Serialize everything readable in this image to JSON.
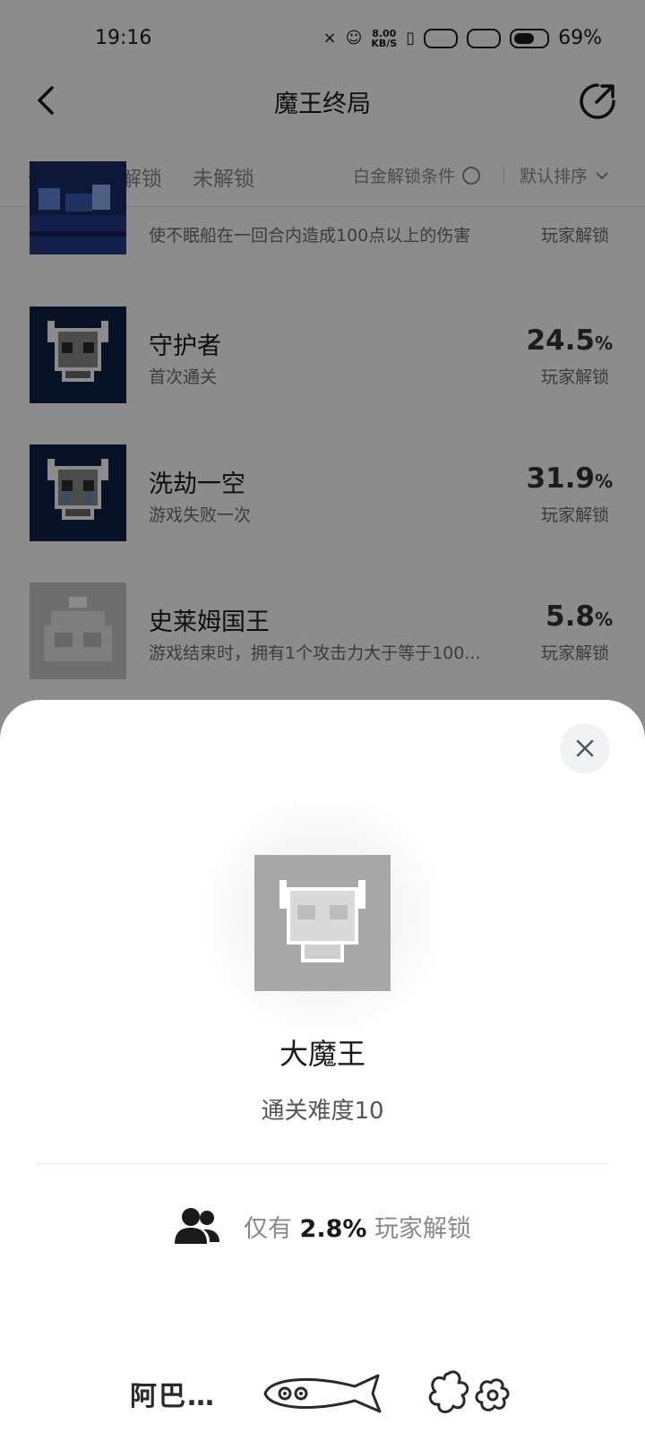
{
  "status_bar": {
    "time": "19:16",
    "speed": "8.00",
    "speed_unit": "KB/S",
    "battery": "69%"
  },
  "nav": {
    "title": "魔王终局"
  },
  "tabs": [
    {
      "label": "全部",
      "active": true
    },
    {
      "label": "已解锁",
      "active": false
    },
    {
      "label": "未解锁",
      "active": false
    }
  ],
  "filters": {
    "platinum_condition": "白金解锁条件",
    "sort": "默认排序"
  },
  "achievements": [
    {
      "title": "",
      "desc": "使不眠船在一回合内造成100点以上的伤害",
      "percent": "",
      "unlock_label": "玩家解锁"
    },
    {
      "title": "守护者",
      "desc": "首次通关",
      "percent": "24.5",
      "unlock_label": "玩家解锁"
    },
    {
      "title": "洗劫一空",
      "desc": "游戏失败一次",
      "percent": "31.9",
      "unlock_label": "玩家解锁"
    },
    {
      "title": "史莱姆国王",
      "desc": "游戏结束时，拥有1个攻击力大于等于100...",
      "percent": "5.8",
      "unlock_label": "玩家解锁"
    }
  ],
  "percent_sign": "%",
  "detail_sheet": {
    "title": "大魔王",
    "condition": "通关难度10",
    "stat_prefix": "仅有",
    "stat_value": "2.8%",
    "stat_suffix": "玩家解锁",
    "footer_text": "阿巴…"
  },
  "colors": {
    "scrim": "rgba(0,0,0,0.45)",
    "badge_dark_bg": "#0f2148",
    "badge_locked_bg": "#a8a8a8"
  }
}
